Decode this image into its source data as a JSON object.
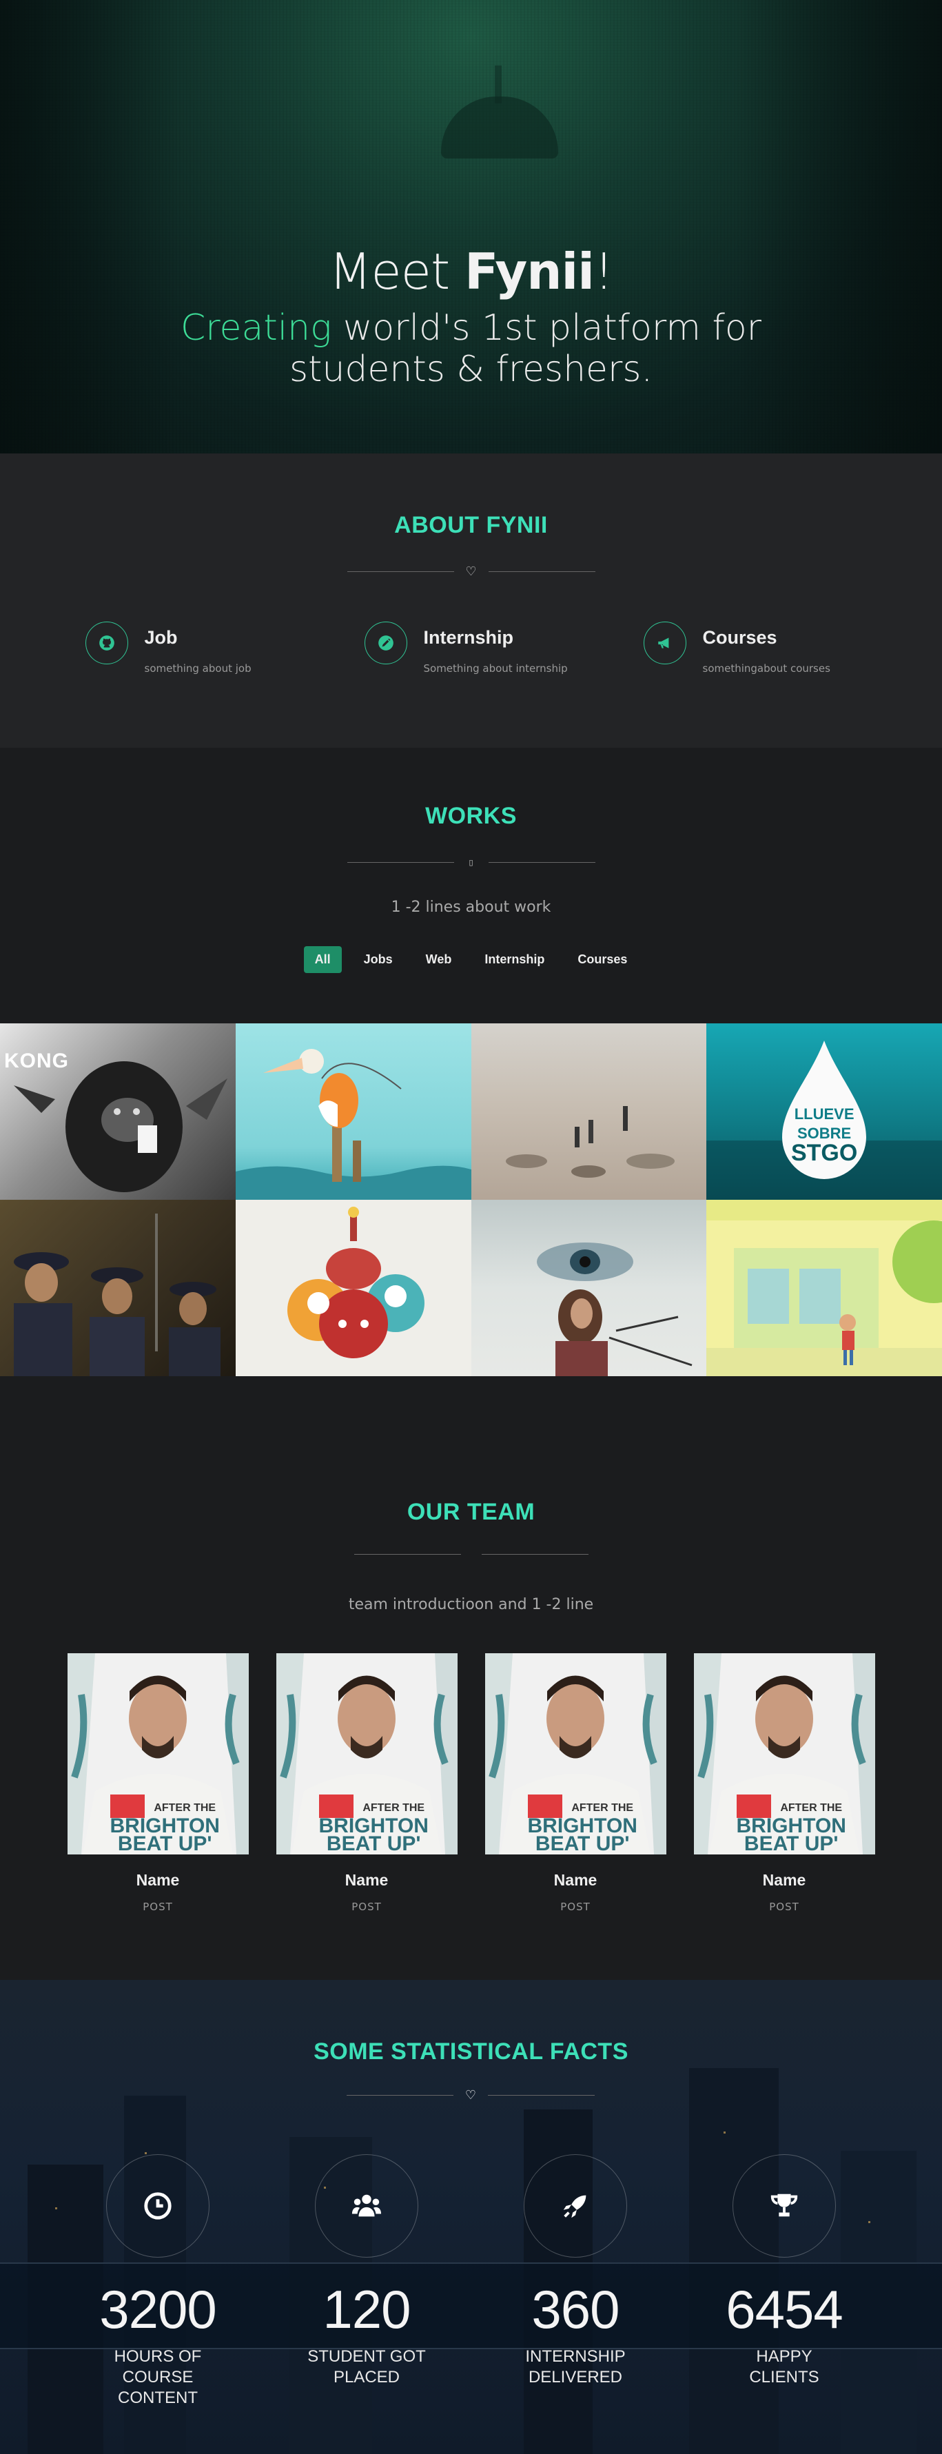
{
  "hero": {
    "title_pre": "Meet ",
    "title_brand": "Fynii",
    "title_post": "!",
    "sub_accent": "Creating",
    "sub_line1": " world's 1st platform for",
    "sub_line2": "students & freshers."
  },
  "about": {
    "title": "ABOUT FYNII",
    "features": [
      {
        "title": "Job",
        "desc": "something about job",
        "icon": "github-icon"
      },
      {
        "title": "Internship",
        "desc": "Something about internship",
        "icon": "pencil-icon"
      },
      {
        "title": "Courses",
        "desc": "somethingabout courses",
        "icon": "megaphone-icon"
      }
    ]
  },
  "works": {
    "title": "WORKS",
    "intro": "1 -2 lines about work",
    "filters": [
      "All",
      "Jobs",
      "Web",
      "Internship",
      "Courses"
    ],
    "active_filter": "All",
    "tile_texts": {
      "kong": "KONG",
      "drop_line1": "LLUEVE",
      "drop_line2": "SOBRE",
      "drop_line3": "STGO"
    }
  },
  "team": {
    "title": "OUR TEAM",
    "intro": "team introductioon and 1 -2 line",
    "members": [
      {
        "name": "Name",
        "post": "POST"
      },
      {
        "name": "Name",
        "post": "POST"
      },
      {
        "name": "Name",
        "post": "POST"
      },
      {
        "name": "Name",
        "post": "POST"
      }
    ],
    "shirt_line1": "AFTER THE",
    "shirt_line2": "BRIGHTON",
    "shirt_line3": "BEAT UP'"
  },
  "stats": {
    "title": "SOME STATISTICAL FACTS",
    "items": [
      {
        "value": "3200",
        "label": "HOURS OF COURSE CONTENT",
        "icon": "clock-icon"
      },
      {
        "value": "120",
        "label": "STUDENT GOT PLACED",
        "icon": "users-icon"
      },
      {
        "value": "360",
        "label": "INTERNSHIP DELIVERED",
        "icon": "rocket-icon"
      },
      {
        "value": "6454",
        "label": "HAPPY CLIENTS",
        "icon": "trophy-icon"
      }
    ]
  },
  "colors": {
    "accent": "#3de0b8",
    "button": "#1e8e67",
    "hero_accent": "#3ddc97"
  }
}
